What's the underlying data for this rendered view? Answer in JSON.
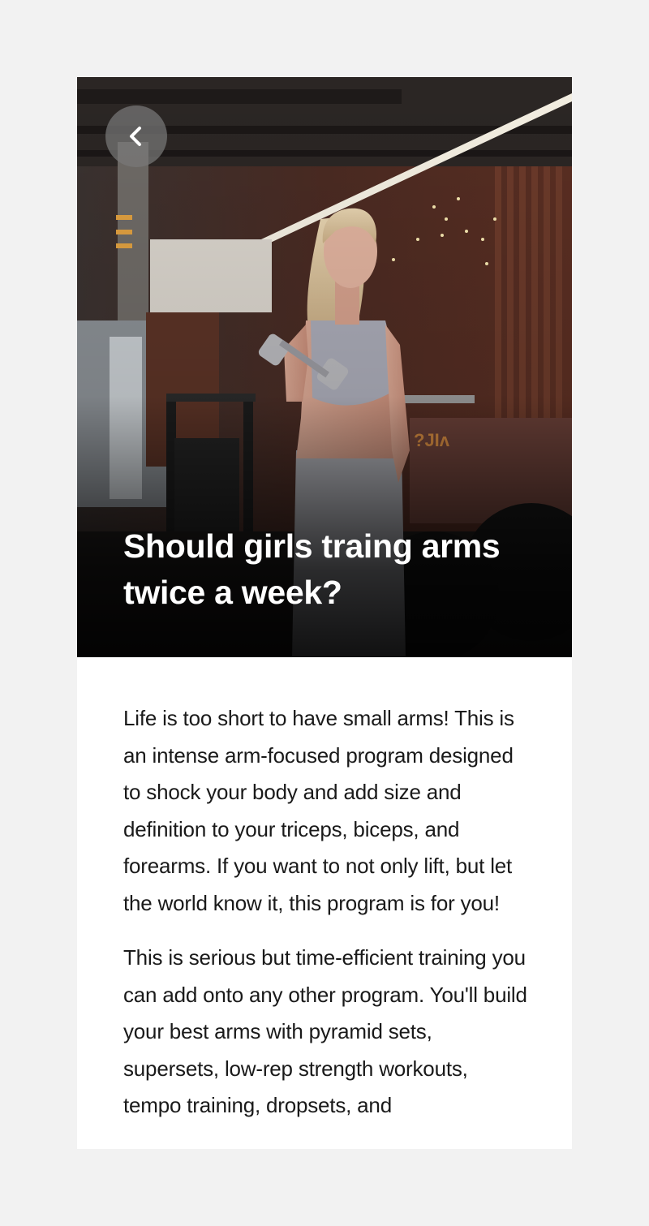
{
  "article": {
    "title": "Should girls traing arms twice a week?",
    "paragraphs": [
      "Life is too short to have small arms! This is an intense arm-focused program designed to shock your body and add size and definition to your triceps, biceps, and forearms. If you want to not only lift, but let the world know it, this program is for you!",
      "This is serious but time-efficient training you can add onto any other program. You'll build your best arms with pyramid sets, supersets, low-rep strength workouts, tempo training, dropsets, and"
    ]
  },
  "header": {
    "back_icon": "chevron-left-icon"
  },
  "colors": {
    "page_background": "#f2f2f2",
    "card_background": "#ffffff",
    "title_text": "#ffffff",
    "body_text": "#1a1a1a",
    "back_button_bg": "#787878"
  }
}
